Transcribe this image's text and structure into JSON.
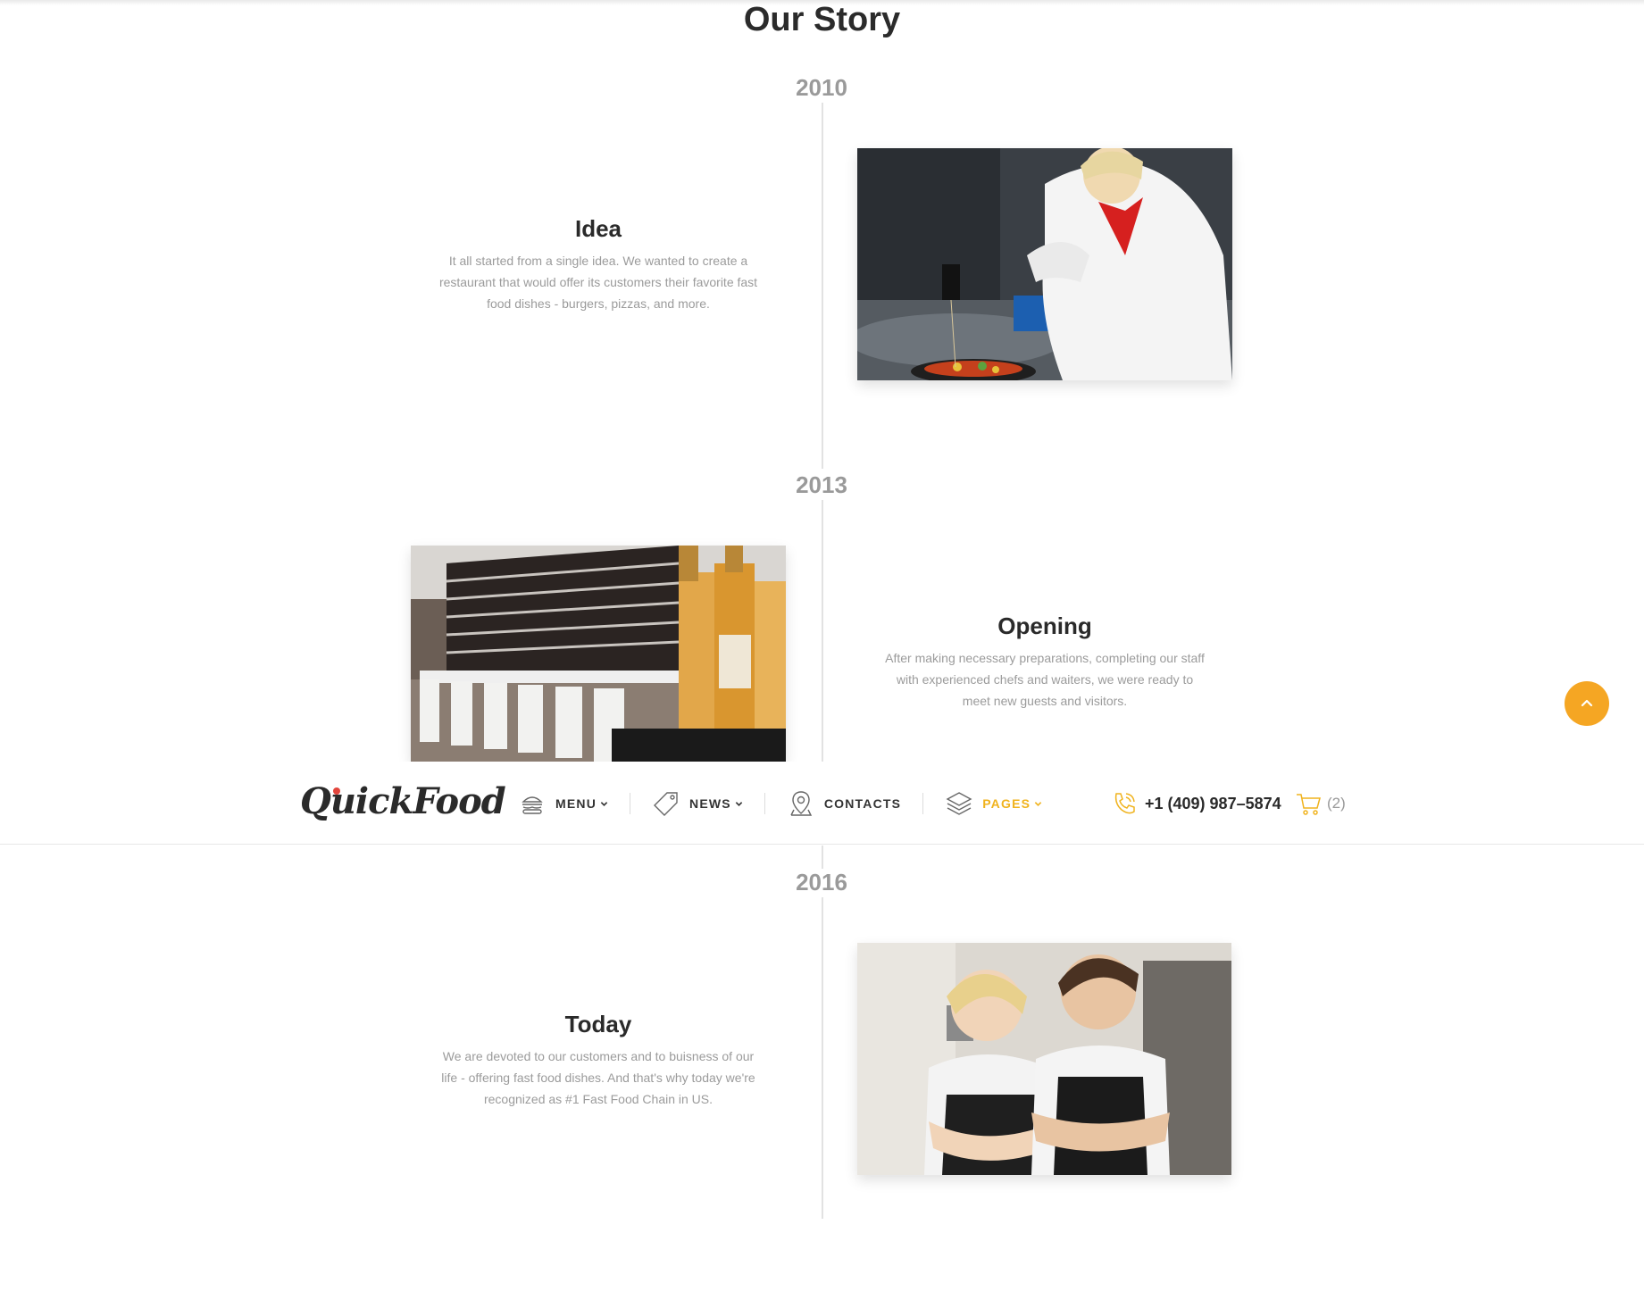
{
  "page": {
    "title": "Our Story",
    "accent_color": "#f5a623"
  },
  "timeline": [
    {
      "year": "2010",
      "title": "Idea",
      "description": "It all started from a single idea. We wanted to create a restaurant that would offer its customers their favorite fast food dishes - burgers, pizzas, and more.",
      "image": "chef-cooking-photo"
    },
    {
      "year": "2013",
      "title": "Opening",
      "description": "After making necessary preparations, completing our staff with experienced chefs and waiters, we were ready to meet new guests and visitors.",
      "image": "restaurant-interior-photo"
    },
    {
      "year": "2016",
      "title": "Today",
      "description": "We are devoted to our customers and to buisness of our life - offering fast food dishes. And that's why today we're recognized as #1 Fast Food Chain in US.",
      "image": "staff-portrait-photo"
    }
  ],
  "header": {
    "logo": "QuickFood",
    "nav": [
      {
        "label": "MENU",
        "icon": "burger-icon",
        "has_dropdown": true,
        "active": false
      },
      {
        "label": "NEWS",
        "icon": "tag-icon",
        "has_dropdown": true,
        "active": false
      },
      {
        "label": "CONTACTS",
        "icon": "map-pin-icon",
        "has_dropdown": false,
        "active": false
      },
      {
        "label": "PAGES",
        "icon": "layers-icon",
        "has_dropdown": true,
        "active": true
      }
    ],
    "phone": "+1 (409) 987–5874",
    "cart_count": "(2)",
    "active_color": "#f0b31e"
  },
  "back_to_top_icon": "chevron-up-icon"
}
